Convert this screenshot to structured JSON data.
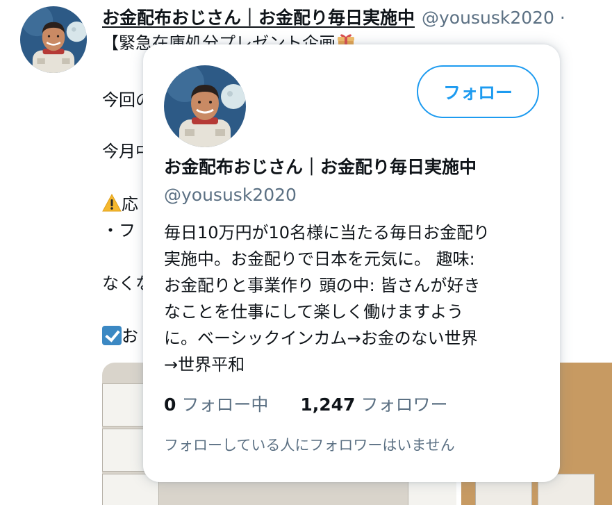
{
  "tweet": {
    "author_name": "お金配布おじさん｜お金配り毎日実施中",
    "author_handle": "@yoususk2020",
    "handle_suffix": "·",
    "lines": [
      "【緊急在庫処分プレゼント企画",
      "今回の",
      "今月中",
      "応",
      "・フ",
      "なくな",
      "お"
    ]
  },
  "hovercard": {
    "name": "お金配布おじさん｜お金配り毎日実施中",
    "handle": "@yoususk2020",
    "follow_label": "フォロー",
    "bio_lines": [
      "毎日10万円が10名様に当たる毎日お金配り",
      "実施中。お金配りで日本を元気に。 趣味:",
      "お金配りと事業作り 頭の中: 皆さんが好き",
      "なことを仕事にして楽しく働けますよう",
      "に。ベーシックインカム→お金のない世界",
      "→世界平和"
    ],
    "following_count": "0",
    "following_label": "フォロー中",
    "followers_count": "1,247",
    "followers_label": "フォロワー",
    "mutual_note": "フォローしている人にフォロワーはいません"
  },
  "icons": {
    "gift": "gift-emoji-icon",
    "warning": "warning-emoji-icon",
    "check": "check-box-emoji-icon"
  },
  "colors": {
    "accent": "#1d9bf0",
    "secondary_text": "#5b7083",
    "primary_text": "#0f1419"
  }
}
